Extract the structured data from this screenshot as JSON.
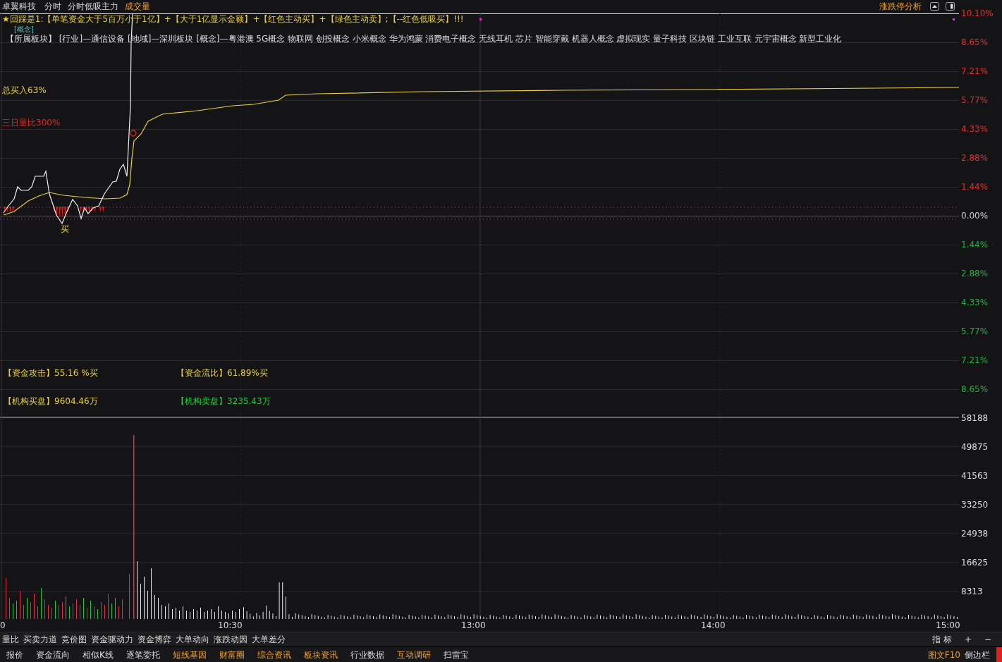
{
  "top_bar": {
    "stock_name": "卓翼科技",
    "tabs": [
      {
        "label": "分时",
        "highlighted": false
      },
      {
        "label": "分时低吸主力",
        "highlighted": false
      },
      {
        "label": "成交量",
        "highlighted": true
      }
    ],
    "right_link": "涨跌停分析"
  },
  "chart": {
    "formula": "★回踩是1:【单笔资金大于5百万小于1亿】+【大于1亿显示金额】+【红色主动买】+【绿色主动卖】;【--红色低吸买】!!!",
    "concept_tag": "[概念]",
    "sectors": "【所属板块】 [行业]—通信设备 [地域]—深圳板块 [概念]—粤港澳 5G概念 物联网 创投概念 小米概念 华为鸿蒙 消费电子概念 无线耳机 芯片 智能穿戴 机器人概念 虚拟现实 量子科技 区块链 工业互联 元宇宙概念 新型工业化",
    "total_buy": "总买入63%",
    "volume_ratio": "三日量比300%",
    "buy_marker": "买",
    "indicators": [
      {
        "label": "【资金攻击】55.16 %买",
        "kind": "buy"
      },
      {
        "label": "【资金流比】61.89%买",
        "kind": "buy"
      },
      {
        "label": "【机构买盘】9604.46万",
        "kind": "buy"
      },
      {
        "label": "【机构卖盘】3235.43万",
        "kind": "sell"
      }
    ]
  },
  "price_axis": [
    {
      "label": "10.10%",
      "kind": "up"
    },
    {
      "label": "8.65%",
      "kind": "up"
    },
    {
      "label": "7.21%",
      "kind": "up"
    },
    {
      "label": "5.77%",
      "kind": "up"
    },
    {
      "label": "4.33%",
      "kind": "up"
    },
    {
      "label": "2.88%",
      "kind": "up"
    },
    {
      "label": "1.44%",
      "kind": "up"
    },
    {
      "label": "0.00%",
      "kind": "flat"
    },
    {
      "label": "1.44%",
      "kind": "down"
    },
    {
      "label": "2.88%",
      "kind": "down"
    },
    {
      "label": "4.33%",
      "kind": "down"
    },
    {
      "label": "5.77%",
      "kind": "down"
    },
    {
      "label": "7.21%",
      "kind": "down"
    },
    {
      "label": "8.65%",
      "kind": "down"
    }
  ],
  "volume_axis": [
    "58188",
    "49875",
    "41563",
    "33250",
    "24938",
    "16625",
    "8313"
  ],
  "time_axis": [
    "0",
    "10:30",
    "13:00",
    "14:00",
    "15:00"
  ],
  "indicator_tabs": [
    "量比",
    "买卖力道",
    "竞价图",
    "资金驱动力",
    "资金博弈",
    "大单动向",
    "涨跌动因",
    "大单差分"
  ],
  "indicator_controls": [
    "指 标",
    "+",
    "−"
  ],
  "bottom_tabs": [
    {
      "label": "报价",
      "highlighted": false
    },
    {
      "label": "资金流向",
      "highlighted": false
    },
    {
      "label": "相似K线",
      "highlighted": false
    },
    {
      "label": "逐笔委托",
      "highlighted": false
    },
    {
      "label": "短线基因",
      "highlighted": true
    },
    {
      "label": "财富圈",
      "highlighted": true
    },
    {
      "label": "综合资讯",
      "highlighted": true
    },
    {
      "label": "板块资讯",
      "highlighted": true
    },
    {
      "label": "行业数据",
      "highlighted": false
    },
    {
      "label": "互动调研",
      "highlighted": true
    },
    {
      "label": "扫雷宝",
      "highlighted": false
    }
  ],
  "bottom_right": [
    {
      "label": "图文F10",
      "highlighted": true
    },
    {
      "label": "侧边栏",
      "highlighted": false
    }
  ]
}
